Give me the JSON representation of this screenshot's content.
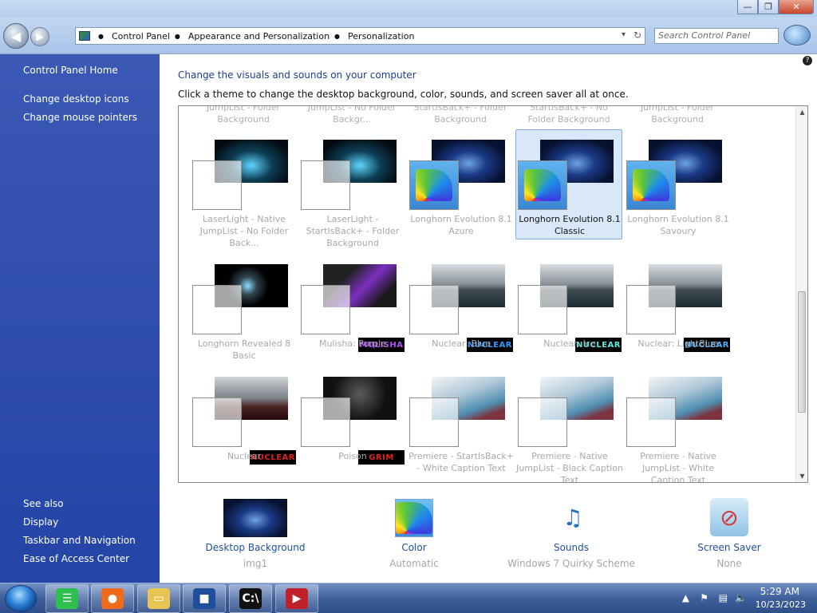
{
  "window": {
    "minimize_glyph": "—",
    "maximize_glyph": "❐",
    "close_glyph": "✕"
  },
  "nav": {
    "back_glyph": "◀",
    "forward_glyph": "▶",
    "breadcrumbs": [
      "Control Panel",
      "Appearance and Personalization",
      "Personalization"
    ],
    "search_placeholder": "Search Control Panel"
  },
  "sidebar": {
    "home": "Control Panel Home",
    "links": [
      "Change desktop icons",
      "Change mouse pointers"
    ],
    "see_also_heading": "See also",
    "see_also": [
      "Display",
      "Taskbar and Navigation",
      "Ease of Access Center"
    ]
  },
  "main": {
    "heading": "Change the visuals and sounds on your computer",
    "description": "Click a theme to change the desktop background, color, sounds, and screen saver all at once.",
    "help_glyph": "?"
  },
  "themes_partial_top": [
    "JumpList - Folder Background",
    "JumpList - No Folder Backgr...",
    "StartIsBack+ - Folder Background",
    "StartIsBack+ - No Folder Background",
    "JumpList - Folder Background"
  ],
  "themes": [
    {
      "label": "LaserLight - Native JumpList - No Folder Back...",
      "bg": "teal",
      "square": "plain",
      "selected": false
    },
    {
      "label": "LaserLight - StartIsBack+ - Folder Background",
      "bg": "teal",
      "square": "plain",
      "selected": false
    },
    {
      "label": "Longhorn Evolution 8.1 Azure",
      "bg": "space",
      "square": "rainbow",
      "selected": false
    },
    {
      "label": "Longhorn Evolution 8.1 Classic",
      "bg": "space",
      "square": "rainbow",
      "selected": true
    },
    {
      "label": "Longhorn Evolution 8.1 Savoury",
      "bg": "space",
      "square": "rainbow",
      "selected": false
    },
    {
      "label": "Longhorn Revealed 8 Basic",
      "bg": "orb",
      "square": "plain",
      "selected": false
    },
    {
      "label": "Mulisha: Purple",
      "bg": "purple",
      "square": "plain",
      "badge": "MULISHA",
      "badge_color": "#b150ff",
      "selected": false
    },
    {
      "label": "Nuclear: Blue",
      "bg": "storm",
      "square": "plain",
      "badge": "NUCLEAR",
      "badge_color": "#2f9dff",
      "selected": false
    },
    {
      "label": "Nuclear: Ice",
      "bg": "storm",
      "square": "plain",
      "badge": "NUCLEAR",
      "badge_color": "#63e6e0",
      "selected": false
    },
    {
      "label": "Nuclear: LightBlue",
      "bg": "storm",
      "square": "plain",
      "badge": "NUCLEAR",
      "badge_color": "#4fb6ff",
      "selected": false
    },
    {
      "label": "Nuclear",
      "bg": "red",
      "square": "plain",
      "badge": "NUCLEAR",
      "badge_color": "#e02020",
      "selected": false
    },
    {
      "label": "Poison",
      "bg": "dark",
      "square": "plain",
      "badge": "GRIM",
      "badge_color": "#e02020",
      "selected": false
    },
    {
      "label": "Premiere - StartIsBack+ - White Caption Text",
      "bg": "waves",
      "square": "plain",
      "selected": false
    },
    {
      "label": "Premiere - Native JumpList - Black Caption Text",
      "bg": "waves",
      "square": "plain",
      "selected": false
    },
    {
      "label": "Premiere - Native JumpList - White Caption Text",
      "bg": "waves",
      "square": "plain",
      "selected": false
    }
  ],
  "scroll": {
    "up_glyph": "▲",
    "down_glyph": "▼"
  },
  "bottom": {
    "desktop_background": {
      "label": "Desktop Background",
      "sub": "img1"
    },
    "color": {
      "label": "Color",
      "sub": "Automatic"
    },
    "sounds": {
      "label": "Sounds",
      "sub": "Windows 7 Quirky Scheme",
      "glyph": "♫"
    },
    "screen_saver": {
      "label": "Screen Saver",
      "sub": "None",
      "glyph": "⊘"
    }
  },
  "taskbar": {
    "apps": [
      {
        "name": "messenger",
        "glyph": "☰",
        "color": "#2fbf4f"
      },
      {
        "name": "firefox",
        "glyph": "●",
        "color": "#f06a1c"
      },
      {
        "name": "file-explorer",
        "glyph": "▭",
        "color": "#e8c455"
      },
      {
        "name": "virtualbox",
        "glyph": "■",
        "color": "#1f4f9a"
      },
      {
        "name": "command-prompt",
        "glyph": "C:\\",
        "color": "#111111"
      },
      {
        "name": "media-app",
        "glyph": "▶",
        "color": "#c0202a"
      }
    ],
    "tray_arrow": "▲",
    "time": "5:29 AM",
    "date": "10/23/2023"
  },
  "colors": {
    "sidebar": "#2c4cab",
    "link": "#1e4f9e",
    "selected_tile": "#d8e8f8"
  }
}
